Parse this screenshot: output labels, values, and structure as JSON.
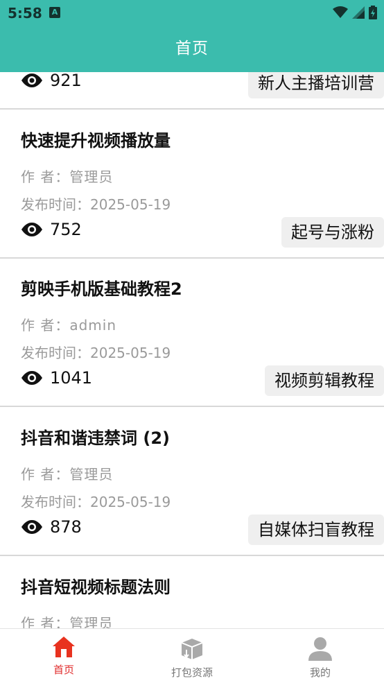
{
  "status": {
    "time": "5:58",
    "notif_letter": "A"
  },
  "appbar": {
    "title": "首页"
  },
  "labels": {
    "author_prefix": "作 者：",
    "date_prefix": "发布时间："
  },
  "articles": [
    {
      "title": "",
      "author": "",
      "date": "",
      "views": "921",
      "tag": "新人主播培训营"
    },
    {
      "title": "快速提升视频播放量",
      "author": "管理员",
      "date": "2025-05-19",
      "views": "752",
      "tag": "起号与涨粉"
    },
    {
      "title": "剪映手机版基础教程2",
      "author": "admin",
      "date": "2025-05-19",
      "views": "1041",
      "tag": "视频剪辑教程"
    },
    {
      "title": "抖音和谐违禁词 (2)",
      "author": "管理员",
      "date": "2025-05-19",
      "views": "878",
      "tag": "自媒体扫盲教程"
    },
    {
      "title": "抖音短视频标题法则",
      "author": "管理员",
      "date": "",
      "views": "",
      "tag": ""
    }
  ],
  "tabs": [
    {
      "label": "首页",
      "icon": "home-icon",
      "active": true
    },
    {
      "label": "打包资源",
      "icon": "package-icon",
      "active": false
    },
    {
      "label": "我的",
      "icon": "user-icon",
      "active": false
    }
  ],
  "colors": {
    "primary": "#3bbcad",
    "active_tab": "#e02b2b",
    "home_icon": "#e8321f"
  }
}
